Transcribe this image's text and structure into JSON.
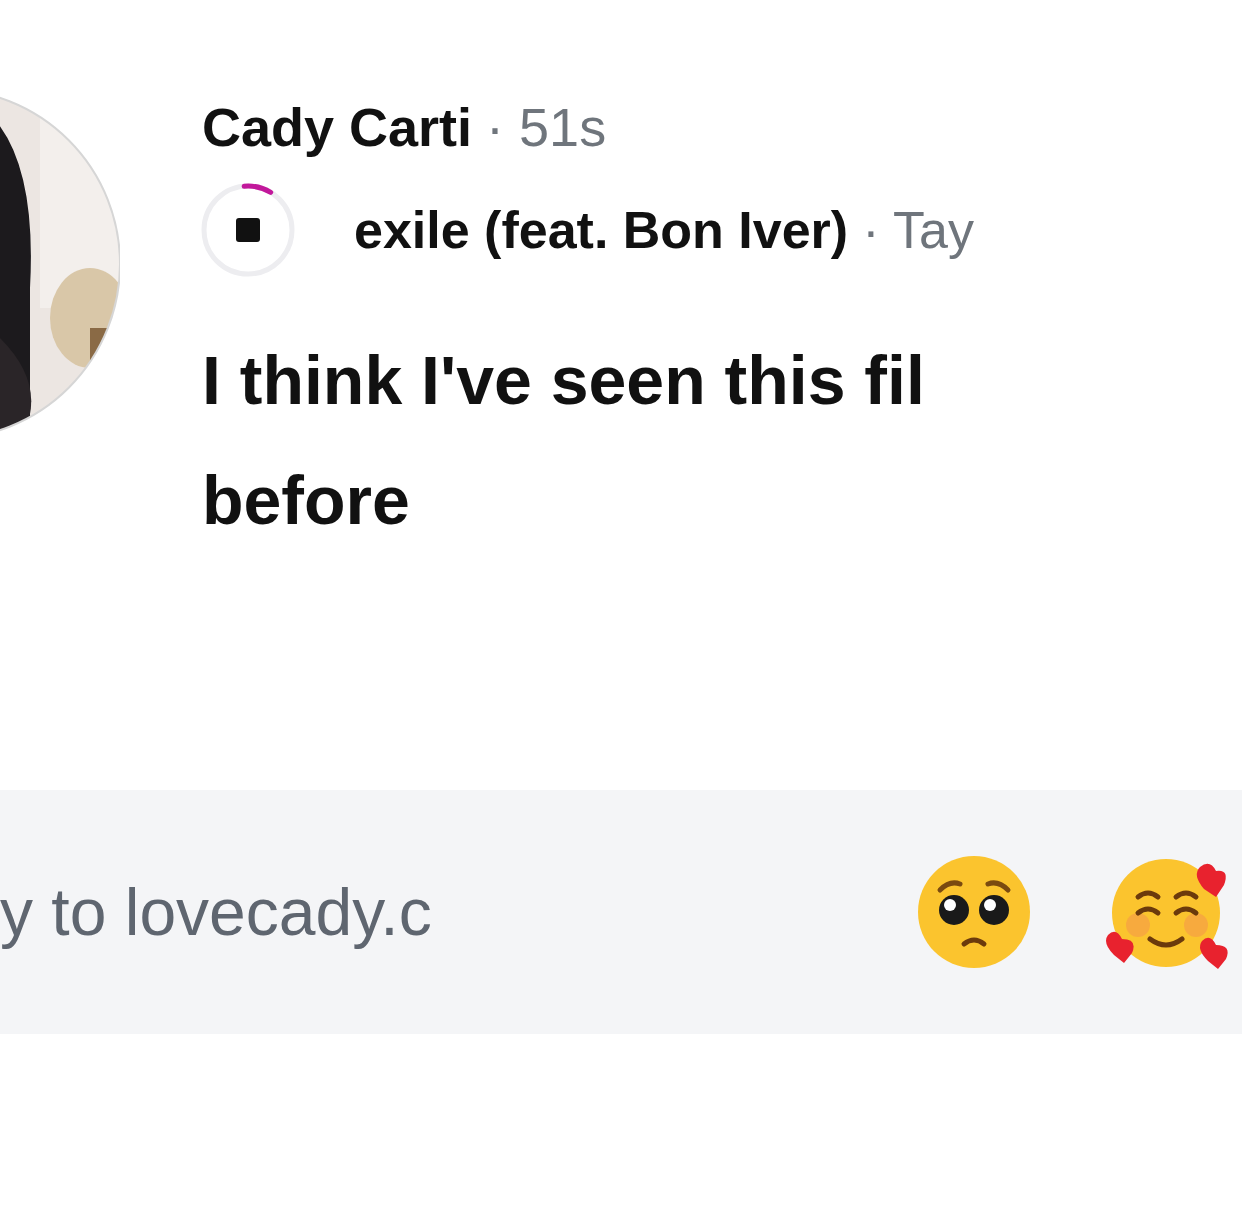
{
  "post": {
    "author": "Cady Carti",
    "time": "· 51s",
    "song": {
      "title": "exile (feat. Bon Iver)",
      "artist": "· Tay",
      "level": 0.1
    },
    "text_lines": [
      "I think I've seen this fil",
      "before"
    ]
  },
  "reply": {
    "placeholder": "y to lovecady.c"
  }
}
